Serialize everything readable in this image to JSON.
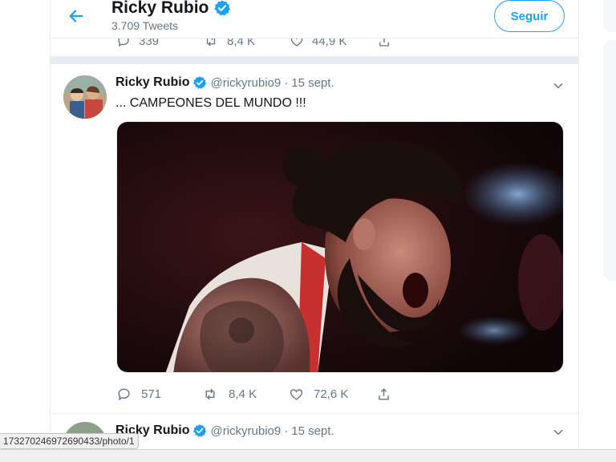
{
  "header": {
    "title": "Ricky Rubio",
    "tweet_count": "3.709 Tweets",
    "follow_label": "Seguir"
  },
  "prev_tweet": {
    "replies": "339",
    "retweets": "8,4 K",
    "likes": "44,9 K"
  },
  "tweet": {
    "name": "Ricky Rubio",
    "handle": "@rickyrubio9",
    "dot": "·",
    "date": "15 sept.",
    "text": "... CAMPEONES DEL MUNDO !!!",
    "replies": "571",
    "retweets": "8,4 K",
    "likes": "72,6 K"
  },
  "next_tweet": {
    "name": "Ricky Rubio",
    "handle": "@rickyrubio9",
    "dot": "·",
    "date": "15 sept."
  },
  "status_bar": {
    "url": "1732702469726904​33/photo/1"
  },
  "colors": {
    "accent": "#1da1f2",
    "text": "#14171a",
    "secondary": "#657786",
    "border": "#e6ecf0"
  },
  "icons": [
    "back-arrow-icon",
    "verified-badge-icon",
    "reply-icon",
    "retweet-icon",
    "like-icon",
    "share-icon",
    "chevron-down-icon"
  ]
}
